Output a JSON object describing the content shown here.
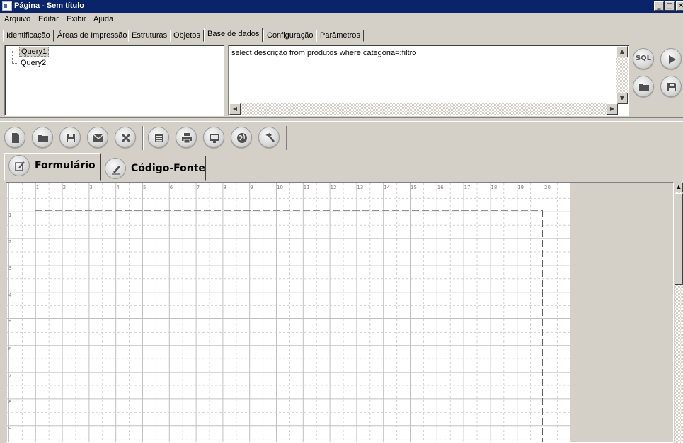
{
  "window": {
    "title": "Página - Sem título",
    "minimize": "_",
    "maximize": "□",
    "close": "✕"
  },
  "menu": [
    "Arquivo",
    "Editar",
    "Exibir",
    "Ajuda"
  ],
  "top_tabs": [
    {
      "label": "Identificação",
      "active": false
    },
    {
      "label": "Áreas de Impressão",
      "active": false
    },
    {
      "label": "Estruturas",
      "active": false
    },
    {
      "label": "Objetos",
      "active": false
    },
    {
      "label": "Base de dados",
      "active": true
    },
    {
      "label": "Configuração",
      "active": false
    },
    {
      "label": "Parâmetros",
      "active": false
    }
  ],
  "queries": [
    {
      "label": "Query1",
      "selected": true
    },
    {
      "label": "Query2",
      "selected": false
    }
  ],
  "sql_editor": {
    "text": "select descrição from produtos where categoria=:filtro"
  },
  "side_buttons": {
    "sql_label": "SQL",
    "icons": [
      "sql-icon",
      "play-icon",
      "folder-icon",
      "save-icon"
    ]
  },
  "toolbar": {
    "icons": [
      "new-document-icon",
      "open-folder-icon",
      "save-icon",
      "mail-icon",
      "close-icon",
      "form-icon",
      "print-icon",
      "monitor-icon",
      "globe-icon",
      "hammer-icon"
    ]
  },
  "view_tabs": [
    {
      "label": "Formulário",
      "icon": "edit-form-icon",
      "active": true
    },
    {
      "label": "Código-Fonte",
      "icon": "pencil-icon",
      "active": false
    }
  ],
  "ruler": {
    "horizontal": [
      "1",
      "2",
      "3",
      "4",
      "5",
      "6",
      "7",
      "8",
      "9",
      "10",
      "11",
      "12",
      "13",
      "14",
      "15",
      "16",
      "17",
      "18",
      "19",
      "20"
    ],
    "vertical": [
      "1",
      "2",
      "3",
      "4",
      "5",
      "6",
      "7",
      "8",
      "9"
    ]
  },
  "colors": {
    "titlebar": "#0a246a",
    "face": "#d4d0c8",
    "grid_major": "#c0c0c0",
    "grid_minor": "#d0d0d0"
  }
}
